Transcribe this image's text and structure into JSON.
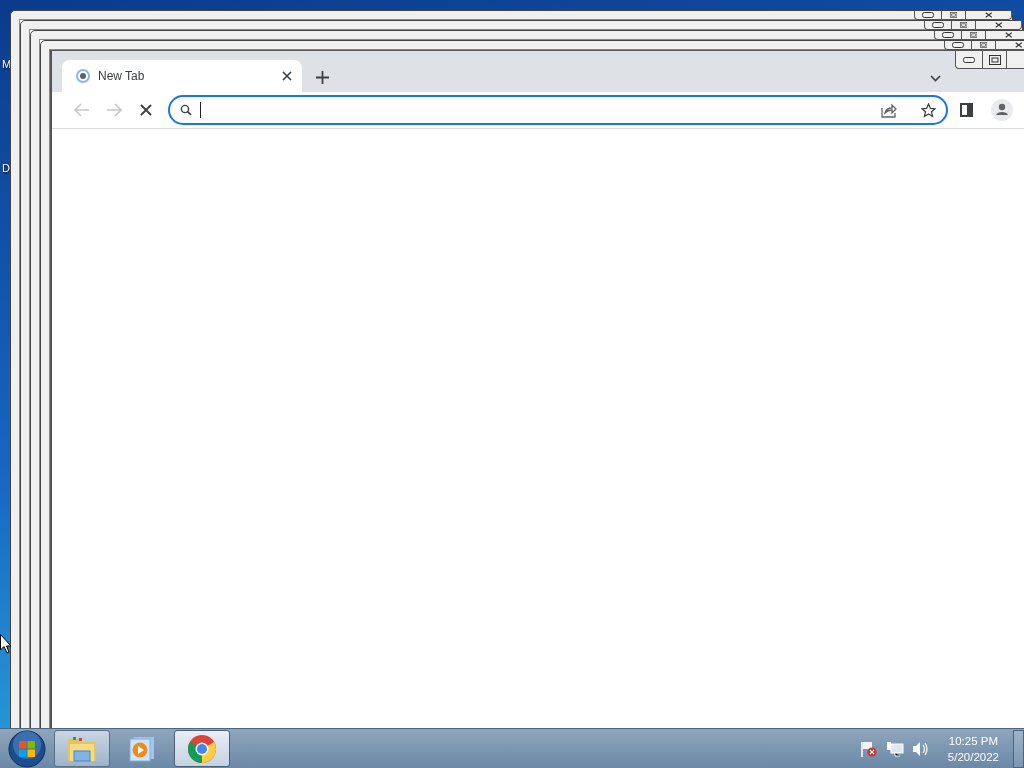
{
  "desktop_icons": [
    {
      "label": "M"
    },
    {
      "label": "D"
    }
  ],
  "browser": {
    "tabs": [
      {
        "title": "New Tab",
        "selected": true
      }
    ],
    "loading": true,
    "back": {
      "disabled": true
    },
    "forward": {
      "disabled": true
    }
  },
  "taskbar": {
    "items": [
      {
        "kind": "explorer",
        "running": true,
        "selected": false
      },
      {
        "kind": "media",
        "running": false,
        "selected": false
      },
      {
        "kind": "chrome",
        "running": true,
        "selected": true
      }
    ],
    "clock": {
      "time": "10:25 PM",
      "date": "5/20/2022"
    }
  }
}
